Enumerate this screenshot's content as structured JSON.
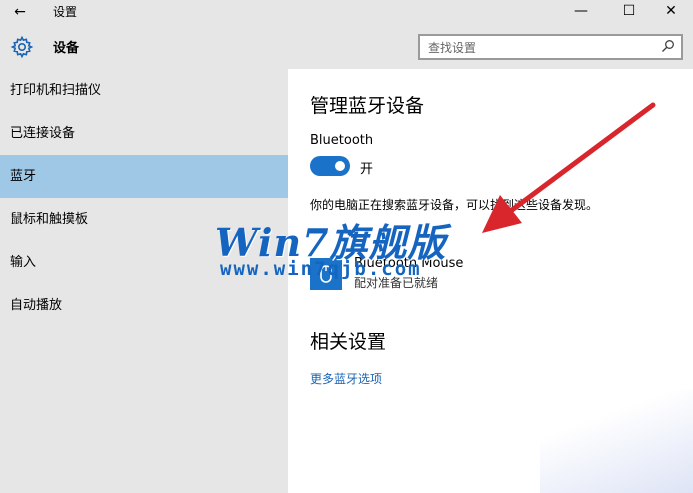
{
  "window": {
    "back_glyph": "←",
    "title": "设置",
    "minimize_glyph": "—",
    "maximize_glyph": "☐",
    "close_glyph": "✕"
  },
  "header": {
    "title": "设备",
    "icon": "gear-icon"
  },
  "search": {
    "placeholder": "查找设置",
    "icon": "search-icon"
  },
  "sidebar": {
    "items": [
      {
        "label": "打印机和扫描仪",
        "selected": false
      },
      {
        "label": "已连接设备",
        "selected": false
      },
      {
        "label": "蓝牙",
        "selected": true
      },
      {
        "label": "鼠标和触摸板",
        "selected": false
      },
      {
        "label": "输入",
        "selected": false
      },
      {
        "label": "自动播放",
        "selected": false
      }
    ]
  },
  "main": {
    "title": "管理蓝牙设备",
    "bluetooth_label": "Bluetooth",
    "toggle_state": "开",
    "toggle_on": true,
    "searching_text": "你的电脑正在搜索蓝牙设备，可以找到这些设备发现。",
    "device": {
      "name": "Bluetooth Mouse",
      "status": "配对准备已就绪",
      "icon": "bluetooth-mouse-icon"
    },
    "related_title": "相关设置",
    "more_link": "更多蓝牙选项"
  },
  "watermark": {
    "logo": "Win7旗舰版",
    "url": "www.win7qjb.com"
  },
  "colors": {
    "accent": "#1a73c9",
    "selected_bg": "#9fc8e6",
    "sidebar_bg": "#e6e6e6",
    "arrow": "#d8262c",
    "watermark": "#1565c0"
  }
}
